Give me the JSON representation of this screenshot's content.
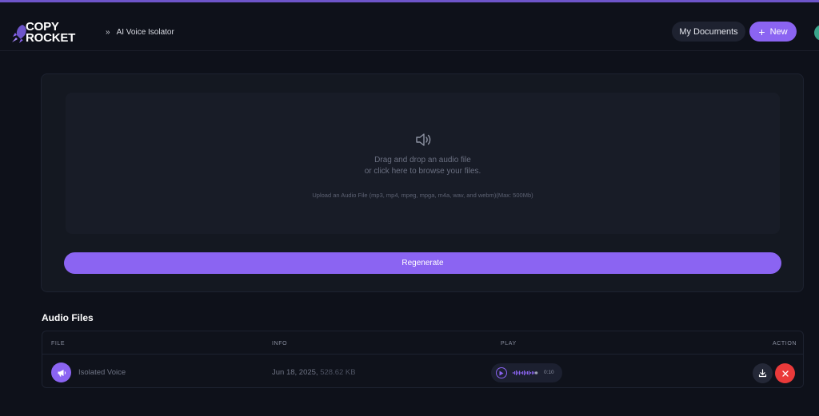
{
  "brand": {
    "line1": "COPY",
    "line2": "ROCKET",
    "icon": "rocket-icon"
  },
  "breadcrumb": {
    "separator_icon": "double-chevron-right-icon",
    "current": "AI Voice Isolator"
  },
  "header": {
    "my_documents": "My Documents",
    "new_label": "New",
    "new_icon": "plus-icon"
  },
  "upload": {
    "icon": "speaker-icon",
    "line1": "Drag and drop an audio file",
    "line2": "or click here to browse your files.",
    "hint": "Upload an Audio File (mp3, mp4, mpeg, mpga, m4a, wav, and webm)(Max: 500Mb)",
    "regenerate": "Regenerate"
  },
  "audio_files": {
    "title": "Audio Files",
    "columns": [
      "FILE",
      "INFO",
      "PLAY",
      "ACTION"
    ],
    "rows": [
      {
        "icon": "megaphone-icon",
        "name": "Isolated Voice",
        "date": "Jun 18, 2025,",
        "size": "528.62 KB",
        "duration": "0:10",
        "actions": [
          "download-icon",
          "close-icon"
        ]
      }
    ]
  },
  "colors": {
    "accent": "#8b64f2",
    "background": "#0e111a",
    "panel": "#141821",
    "danger": "#ea3a3a"
  }
}
